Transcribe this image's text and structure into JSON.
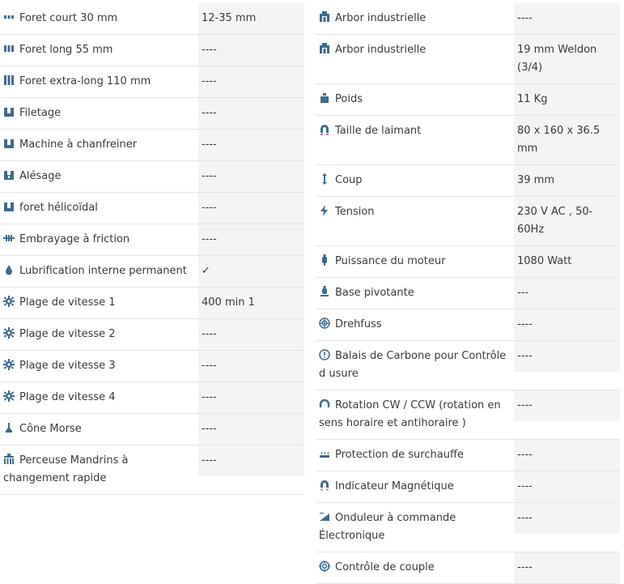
{
  "left": [
    {
      "label": "Foret court 30 mm",
      "value": "12-35 mm",
      "icon": "short-drill-icon"
    },
    {
      "label": "Foret long 55 mm",
      "value": "----",
      "icon": "long-drill-icon"
    },
    {
      "label": "Foret extra-long 110 mm",
      "value": "----",
      "icon": "extra-long-drill-icon"
    },
    {
      "label": "Filetage",
      "value": "----",
      "icon": "threading-icon"
    },
    {
      "label": "Machine à chanfreiner",
      "value": "----",
      "icon": "chamfer-icon"
    },
    {
      "label": "Alésage",
      "value": "----",
      "icon": "reaming-icon"
    },
    {
      "label": "foret hélicoïdal",
      "value": "----",
      "icon": "twist-drill-icon"
    },
    {
      "label": "Embrayage à friction",
      "value": "----",
      "icon": "friction-clutch-icon"
    },
    {
      "label": "Lubrification interne permanent",
      "value": "✓",
      "icon": "lubrication-drop-icon"
    },
    {
      "label": "Plage de vitesse 1",
      "value": "400 min 1",
      "icon": "gear-icon"
    },
    {
      "label": "Plage de vitesse 2",
      "value": "----",
      "icon": "gear-icon"
    },
    {
      "label": "Plage de vitesse 3",
      "value": "----",
      "icon": "gear-icon"
    },
    {
      "label": "Plage de vitesse 4",
      "value": "----",
      "icon": "gear-icon"
    },
    {
      "label": "Cône Morse",
      "value": "----",
      "icon": "morse-taper-icon"
    },
    {
      "label": "Perceuse Mandrins à changement rapide",
      "value": "----",
      "icon": "quick-change-chuck-icon"
    }
  ],
  "right": [
    {
      "label": "Arbor industrielle",
      "value": "----",
      "icon": "arbor-icon"
    },
    {
      "label": "Arbor industrielle",
      "value": "19 mm Weldon (3/4)",
      "icon": "arbor-icon"
    },
    {
      "label": "Poids",
      "value": "11 Kg",
      "icon": "weight-icon"
    },
    {
      "label": "Taille de laimant",
      "value": "80 x 160 x 36.5 mm",
      "icon": "magnet-icon"
    },
    {
      "label": "Coup",
      "value": "39 mm",
      "icon": "stroke-icon"
    },
    {
      "label": "Tension",
      "value": "230 V AC , 50-60Hz",
      "icon": "lightning-icon"
    },
    {
      "label": "Puissance du moteur",
      "value": "1080 Watt",
      "icon": "motor-power-icon"
    },
    {
      "label": "Base pivotante",
      "value": "---",
      "icon": "swivel-base-icon"
    },
    {
      "label": "Drehfuss",
      "value": "----",
      "icon": "drehfuss-icon"
    },
    {
      "label": "Balais de Carbone pour Contrôle d usure",
      "value": "----",
      "icon": "carbon-brush-icon"
    },
    {
      "label": "Rotation CW / CCW (rotation en sens horaire et antihoraire )",
      "value": "----",
      "icon": "rotation-icon"
    },
    {
      "label": "Protection de surchauffe",
      "value": "----",
      "icon": "overheat-protection-icon"
    },
    {
      "label": "Indicateur Magnétique",
      "value": "----",
      "icon": "magnet-indicator-icon"
    },
    {
      "label": "Onduleur à commande Électronique",
      "value": "----",
      "icon": "electronic-inverter-icon"
    },
    {
      "label": "Contrôle de couple",
      "value": "----",
      "icon": "torque-control-icon"
    }
  ],
  "colors": {
    "icon": "#3d6b8f",
    "value_bg": "#f4f4f4",
    "border": "#e4e4e4",
    "text": "#3a3a3a"
  }
}
